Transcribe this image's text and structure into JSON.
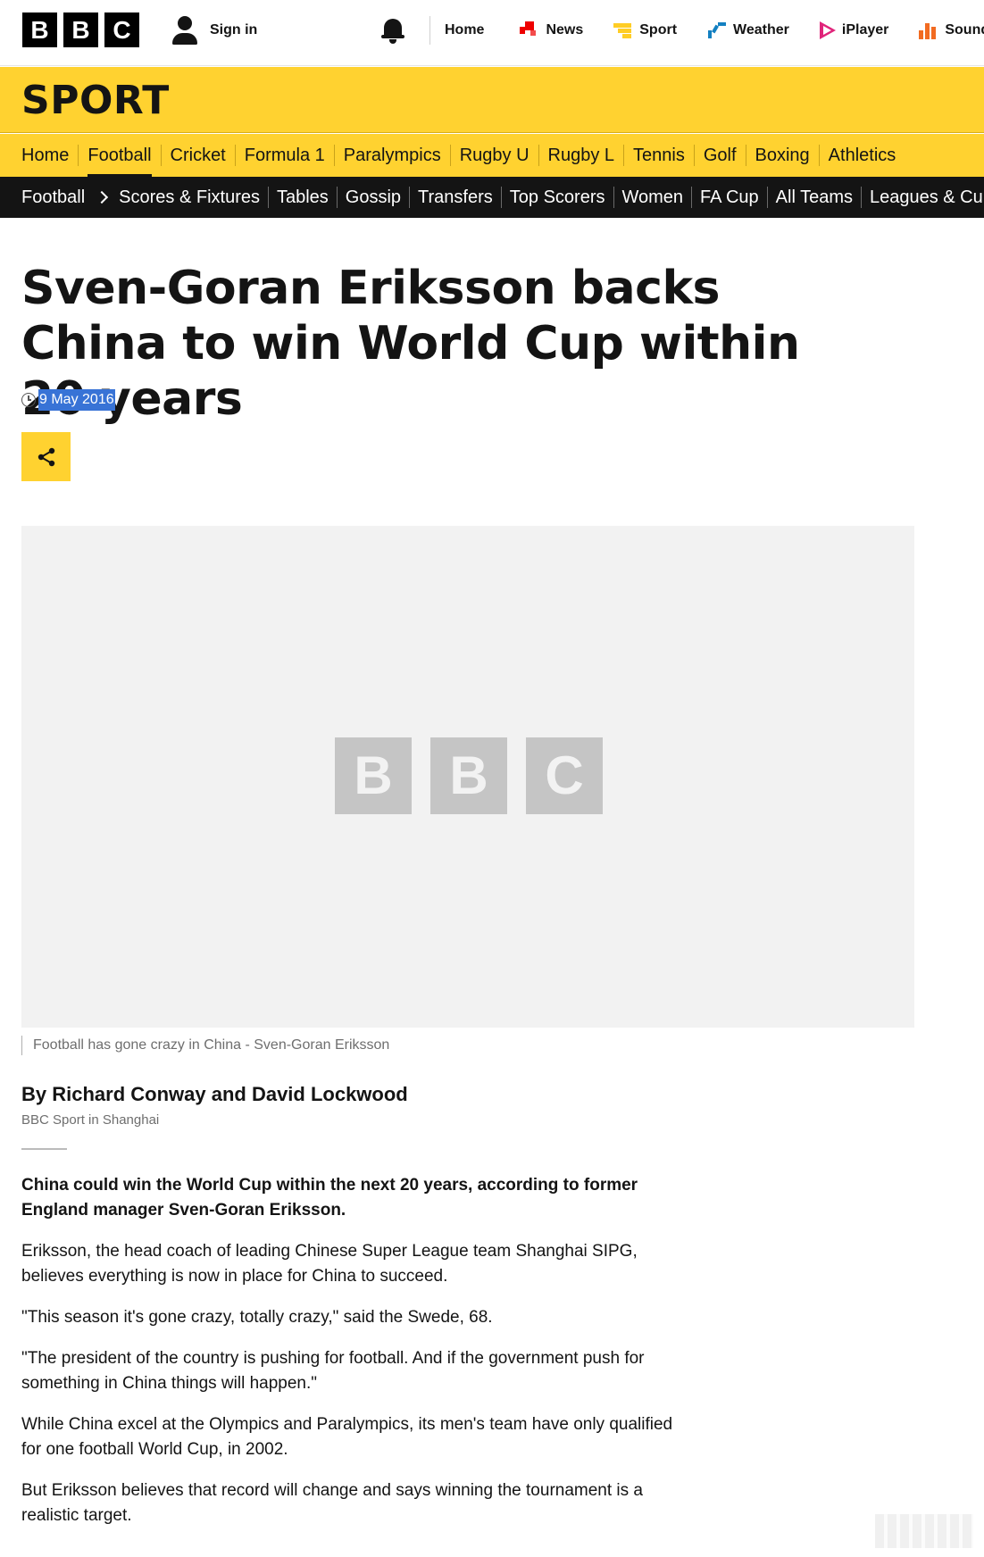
{
  "masthead": {
    "logo_letters": [
      "B",
      "B",
      "C"
    ],
    "sign_in": "Sign in",
    "nav": [
      {
        "label": "Home",
        "icon": "none"
      },
      {
        "label": "News",
        "icon": "news-icon"
      },
      {
        "label": "Sport",
        "icon": "sport-icon"
      },
      {
        "label": "Weather",
        "icon": "weather-icon"
      },
      {
        "label": "iPlayer",
        "icon": "iplayer-icon"
      },
      {
        "label": "Sounds",
        "icon": "sounds-icon"
      }
    ]
  },
  "sport_banner": {
    "title": "SPORT"
  },
  "sport_nav": {
    "items": [
      "Home",
      "Football",
      "Cricket",
      "Formula 1",
      "Paralympics",
      "Rugby U",
      "Rugby L",
      "Tennis",
      "Golf",
      "Boxing",
      "Athletics"
    ],
    "active": "Football"
  },
  "sub_nav": {
    "root": "Football",
    "items": [
      "Scores & Fixtures",
      "Tables",
      "Gossip",
      "Transfers",
      "Top Scorers",
      "Women",
      "FA Cup",
      "All Teams",
      "Leagues & Cups"
    ]
  },
  "article": {
    "headline": "Sven-Goran Eriksson backs China to win World Cup within 20 years",
    "date": "9 May 2016",
    "media_logo": [
      "B",
      "B",
      "C"
    ],
    "caption": "Football has gone crazy in China - Sven-Goran Eriksson",
    "byline": {
      "name": "By Richard Conway and David Lockwood",
      "role": "BBC Sport in Shanghai"
    },
    "paragraphs": [
      "China could win the World Cup within the next 20 years, according to former England manager Sven-Goran Eriksson.",
      "Eriksson, the head coach of leading Chinese Super League team Shanghai SIPG, believes everything is now in place for China to succeed.",
      "\"This season it's gone crazy, totally crazy,\" said the Swede, 68.",
      "\"The president of the country is pushing for football. And if the government push for something in China things will happen.\"",
      "While China excel at the Olympics and Paralympics, its men's team have only qualified for one football World Cup, in 2002.",
      "But Eriksson believes that record will change and says winning the tournament is a realistic target."
    ]
  },
  "colors": {
    "sport_yellow": "#ffd230",
    "subnav_black": "#141414",
    "selection_blue": "#3873d6",
    "news_red": "#ee0000",
    "weather_blue": "#1380c1",
    "iplayer_pink": "#e0247a",
    "sounds_orange": "#f26b21"
  }
}
